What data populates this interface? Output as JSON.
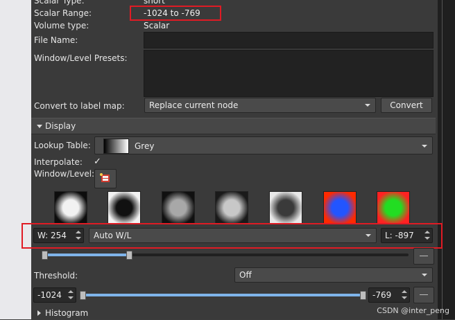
{
  "info": {
    "scalar_type_label": "Scalar Type:",
    "scalar_type_value": "short",
    "scalar_range_label": "Scalar Range:",
    "scalar_range_value": "-1024 to -769",
    "volume_type_label": "Volume type:",
    "volume_type_value": "Scalar",
    "file_name_label": "File Name:",
    "file_name_value": "",
    "presets_label": "Window/Level Presets:"
  },
  "convert": {
    "label": "Convert to label map:",
    "selected": "Replace current node",
    "button": "Convert"
  },
  "display": {
    "header": "Display",
    "lookup_table_label": "Lookup Table:",
    "lookup_table_value": "Grey",
    "interpolate_label": "Interpolate:",
    "interpolate_check": "✓",
    "window_level_label": "Window/Level:",
    "presets": [
      {
        "name": "preset-ct-bone-thumb",
        "colors": [
          "#0d0d0d",
          "#f2f2f2"
        ]
      },
      {
        "name": "preset-ct-air-thumb",
        "colors": [
          "#f2f2f2",
          "#111111"
        ]
      },
      {
        "name": "preset-ct-brain-thumb",
        "colors": [
          "#101010",
          "#a8a8a8"
        ]
      },
      {
        "name": "preset-ct-abdomen-thumb",
        "colors": [
          "#1a1a1a",
          "#c8c8c8"
        ]
      },
      {
        "name": "preset-ct-lung-thumb",
        "colors": [
          "#e8e8e8",
          "#3a3a3a"
        ]
      },
      {
        "name": "preset-pet-thumb",
        "colors": [
          "#ff2a00",
          "#2255ff"
        ]
      },
      {
        "name": "preset-dti-thumb",
        "colors": [
          "#ff2222",
          "#22dd22"
        ]
      }
    ],
    "window_value": "W: 254",
    "wl_mode": "Auto W/L",
    "level_value": "L: -897",
    "wl_slider_fraction": 0.23,
    "threshold_label": "Threshold:",
    "threshold_mode": "Off",
    "threshold_min": "-1024",
    "threshold_max": "-769",
    "histogram_header": "Histogram"
  },
  "colors": {
    "highlight": "#e01b24",
    "slider_fill": "#7fb4ea"
  },
  "watermark": "CSDN @inter_peng"
}
